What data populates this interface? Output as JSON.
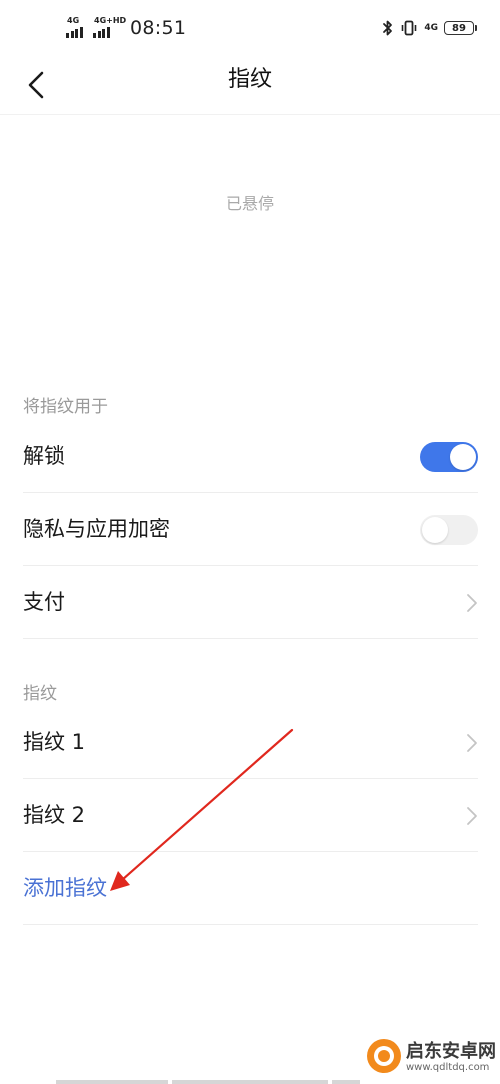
{
  "status_bar": {
    "sim1_network": "4G",
    "sim2_network": "4G+HD",
    "time": "08:51",
    "data_network": "4G",
    "battery": "89"
  },
  "header": {
    "title": "指纹"
  },
  "status": {
    "paused_text": "已悬停"
  },
  "usage_section": {
    "title": "将指纹用于",
    "items": [
      {
        "label": "解锁",
        "toggle": true
      },
      {
        "label": "隐私与应用加密",
        "toggle": false
      },
      {
        "label": "支付"
      }
    ]
  },
  "fingerprint_section": {
    "title": "指纹",
    "items": [
      {
        "label": "指纹 1"
      },
      {
        "label": "指纹 2"
      }
    ],
    "add_label": "添加指纹"
  },
  "watermark": {
    "title": "启东安卓网",
    "url": "www.qdltdq.com"
  },
  "colors": {
    "accent": "#3f77ea",
    "link": "#4a72d4",
    "annotation_arrow": "#e0281e",
    "watermark_orange": "#f28a1c"
  }
}
